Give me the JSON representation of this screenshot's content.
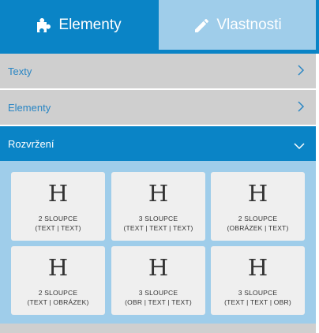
{
  "tabs": [
    {
      "label": "Elementy",
      "icon": "puzzle-icon",
      "active": true
    },
    {
      "label": "Vlastnosti",
      "icon": "pencil-icon",
      "active": false
    }
  ],
  "accordion": [
    {
      "label": "Texty",
      "expanded": false
    },
    {
      "label": "Elementy",
      "expanded": false
    },
    {
      "label": "Rozvržení",
      "expanded": true
    }
  ],
  "layouts": [
    {
      "glyph": "H",
      "title": "2 SLOUPCE",
      "sub": "(TEXT | TEXT)"
    },
    {
      "glyph": "H",
      "title": "3 SLOUPCE",
      "sub": "(TEXT | TEXT | TEXT)"
    },
    {
      "glyph": "H",
      "title": "2 SLOUPCE",
      "sub": "(OBRÁZEK | TEXT)"
    },
    {
      "glyph": "H",
      "title": "2 SLOUPCE",
      "sub": "(TEXT | OBRÁZEK)"
    },
    {
      "glyph": "H",
      "title": "3 SLOUPCE",
      "sub": "(OBR | TEXT | TEXT)"
    },
    {
      "glyph": "H",
      "title": "3 SLOUPCE",
      "sub": "(TEXT | TEXT | OBR)"
    }
  ],
  "colors": {
    "accent": "#0a84c6",
    "accent_light": "#9fcdea",
    "row_gray": "#cfcfcf",
    "card_bg": "#efefef",
    "link_blue": "#2a86c4"
  }
}
